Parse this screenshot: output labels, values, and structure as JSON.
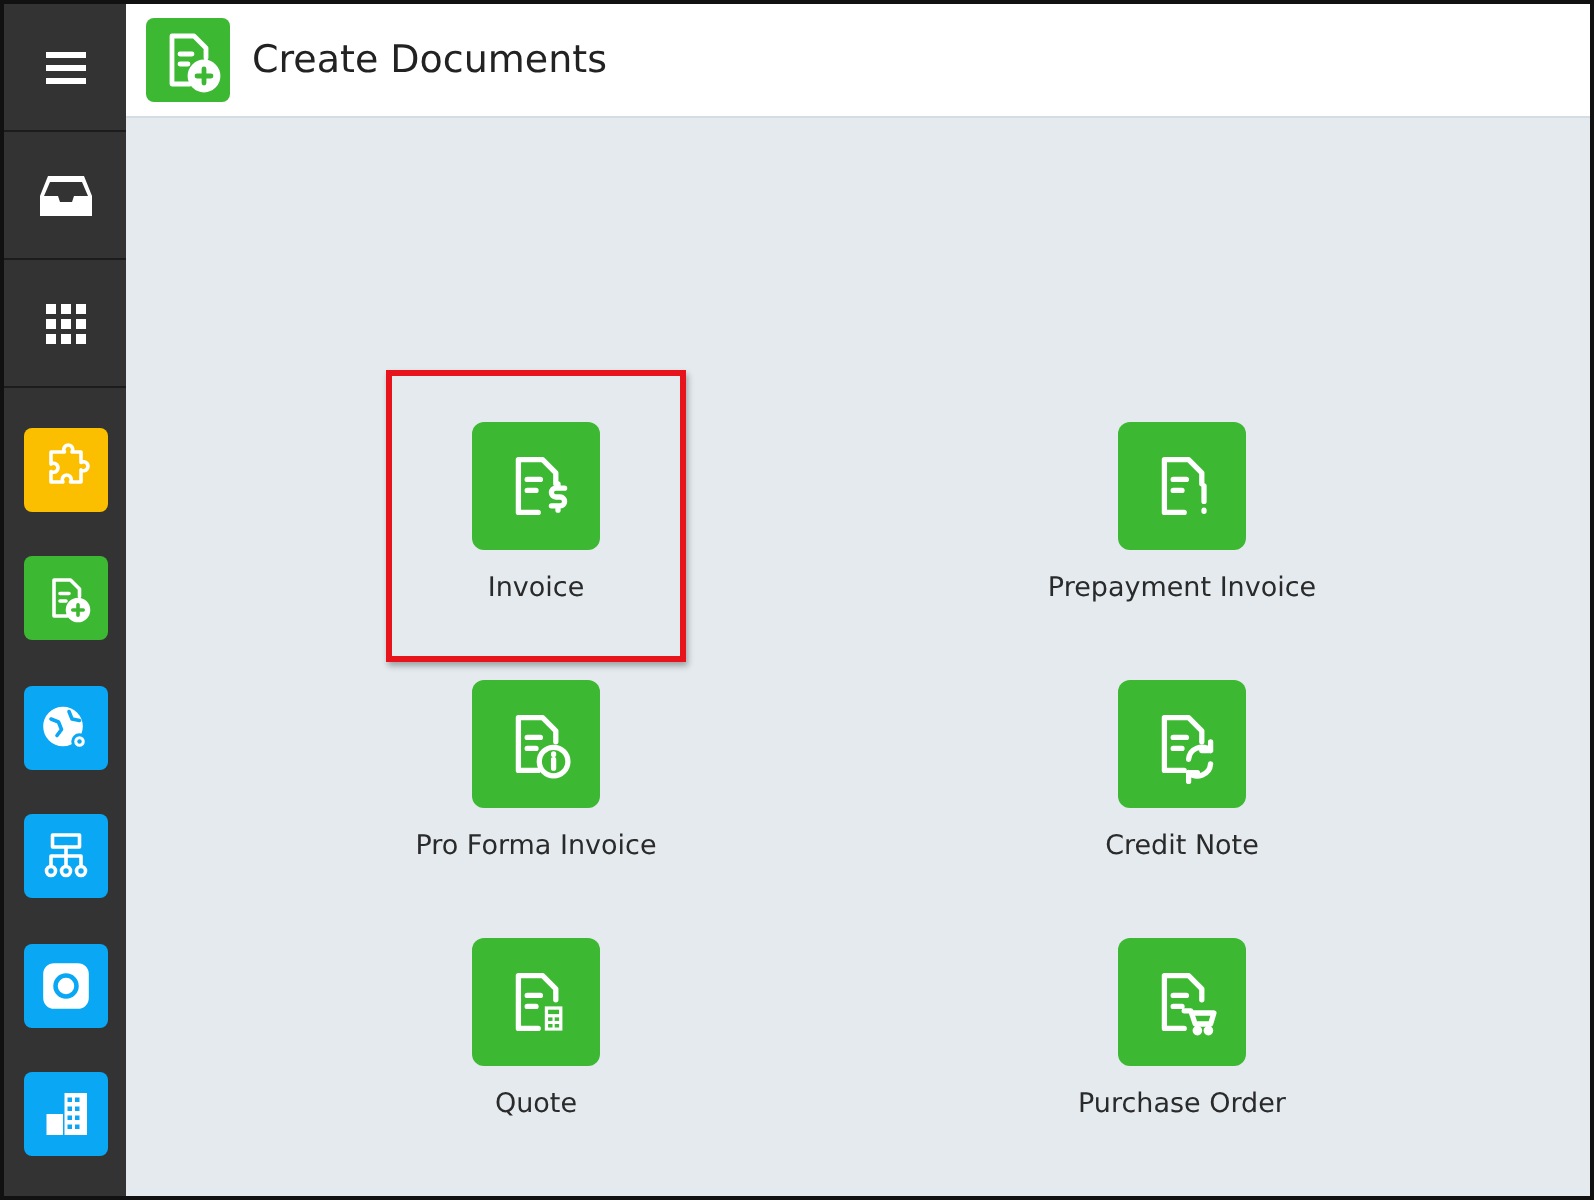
{
  "header": {
    "title": "Create Documents"
  },
  "sidebar": {
    "top_items": [
      {
        "kind": "menu"
      },
      {
        "kind": "inbox"
      },
      {
        "kind": "apps"
      }
    ],
    "items": [
      {
        "kind": "puzzle",
        "color": "#fcbf00"
      },
      {
        "kind": "document-plus",
        "color": "#3db832"
      },
      {
        "kind": "globe-gear",
        "color": "#0aa7f5"
      },
      {
        "kind": "hierarchy",
        "color": "#0aa7f5"
      },
      {
        "kind": "lifebuoy",
        "color": "#0aa7f5"
      },
      {
        "kind": "buildings",
        "color": "#0aa7f5"
      }
    ]
  },
  "documents": [
    {
      "label": "Invoice",
      "kind": "dollar",
      "highlighted": true
    },
    {
      "label": "Prepayment Invoice",
      "kind": "exclamation",
      "highlighted": false
    },
    {
      "label": "Pro Forma Invoice",
      "kind": "info",
      "highlighted": false
    },
    {
      "label": "Credit Note",
      "kind": "refresh",
      "highlighted": false
    },
    {
      "label": "Quote",
      "kind": "calculator",
      "highlighted": false
    },
    {
      "label": "Purchase Order",
      "kind": "cart",
      "highlighted": false
    }
  ]
}
